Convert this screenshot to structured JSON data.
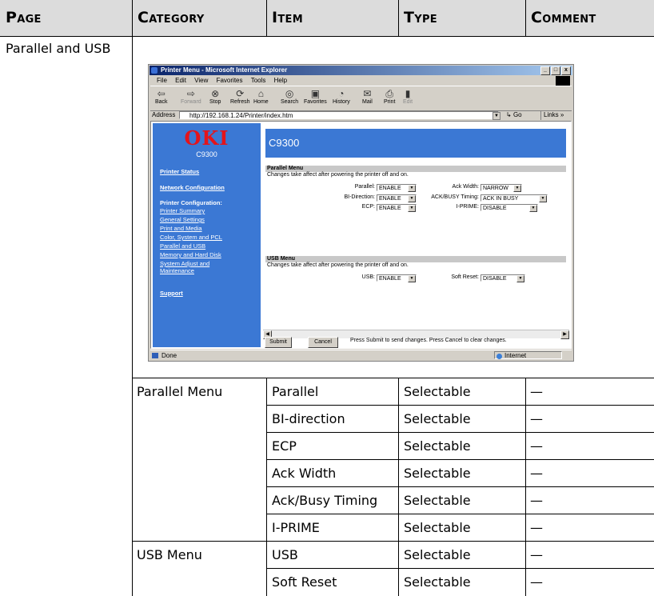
{
  "table": {
    "headers": [
      "Page",
      "Category",
      "Item",
      "Type",
      "Comment"
    ],
    "page_label": "Parallel and USB",
    "rows": [
      {
        "category": "Parallel Menu",
        "item": "Parallel",
        "type": "Selectable",
        "comment": "—"
      },
      {
        "category": "",
        "item": "BI-direction",
        "type": "Selectable",
        "comment": "—"
      },
      {
        "category": "",
        "item": "ECP",
        "type": "Selectable",
        "comment": "—"
      },
      {
        "category": "",
        "item": "Ack Width",
        "type": "Selectable",
        "comment": "—"
      },
      {
        "category": "",
        "item": "Ack/Busy Timing",
        "type": "Selectable",
        "comment": "—"
      },
      {
        "category": "",
        "item": "I-PRIME",
        "type": "Selectable",
        "comment": "—"
      },
      {
        "category": "USB Menu",
        "item": "USB",
        "type": "Selectable",
        "comment": "—"
      },
      {
        "category": "",
        "item": "Soft Reset",
        "type": "Selectable",
        "comment": "—"
      }
    ]
  },
  "browser": {
    "title": "Printer Menu - Microsoft Internet Explorer",
    "menu": [
      "File",
      "Edit",
      "View",
      "Favorites",
      "Tools",
      "Help"
    ],
    "toolbar": {
      "back": "Back",
      "forward": "Forward",
      "stop": "Stop",
      "refresh": "Refresh",
      "home": "Home",
      "search": "Search",
      "favorites": "Favorites",
      "history": "History",
      "mail": "Mail",
      "print": "Print",
      "edit": "Edit"
    },
    "address_label": "Address",
    "address_url": "http://192.168.1.24/Printer/index.htm",
    "go": "Go",
    "links": "Links »",
    "status_text": "Done",
    "zone_text": "Internet",
    "window_buttons": [
      "_",
      "□",
      "x"
    ]
  },
  "page": {
    "logo": "OKI",
    "model": "C9300",
    "nav": {
      "printer_status": "Printer Status",
      "network_configuration": "Network Configuration",
      "printer_configuration": "Printer Configuration:",
      "links": [
        "Printer Summary",
        "General Settings",
        "Print and Media",
        "Color, System and PCL",
        "Parallel and USB",
        "Memory and Hard Disk",
        "System Adjust and",
        "Maintenance"
      ],
      "support": "Support"
    },
    "banner": "C9300",
    "parallel": {
      "title": "Parallel Menu",
      "note": "Changes take affect after powering the printer off and on.",
      "fields": {
        "parallel": {
          "label": "Parallel:",
          "value": "ENABLE"
        },
        "bidir": {
          "label": "BI-Direction:",
          "value": "ENABLE"
        },
        "ecp": {
          "label": "ECP:",
          "value": "ENABLE"
        },
        "ackwidth": {
          "label": "Ack Width:",
          "value": "NARROW"
        },
        "ackbusy": {
          "label": "ACK/BUSY Timing:",
          "value": "ACK IN BUSY"
        },
        "iprime": {
          "label": "I-PRIME:",
          "value": "DISABLE"
        }
      }
    },
    "usb": {
      "title": "USB Menu",
      "note": "Changes take affect after powering the printer off and on.",
      "fields": {
        "usb": {
          "label": "USB:",
          "value": "ENABLE"
        },
        "softreset": {
          "label": "Soft Reset:",
          "value": "DISABLE"
        }
      }
    },
    "buttons": {
      "submit": "Submit",
      "cancel": "Cancel",
      "note": "Press Submit to send changes. Press Cancel to clear changes."
    }
  }
}
